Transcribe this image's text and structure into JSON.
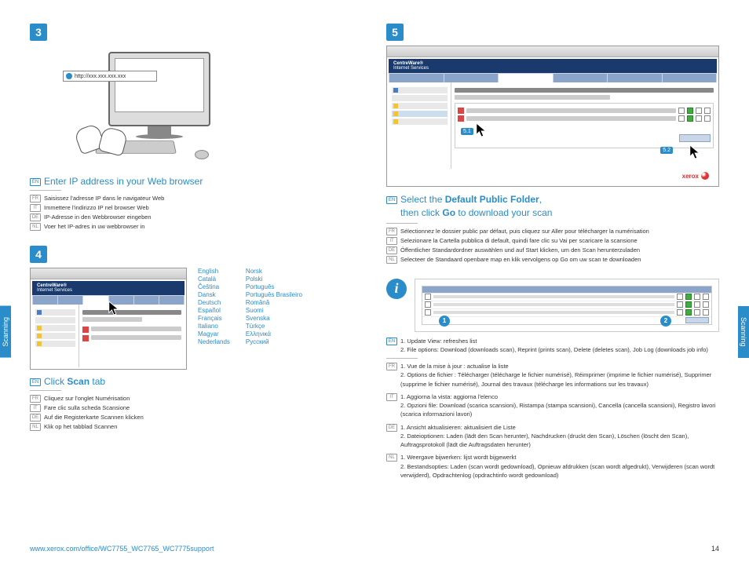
{
  "side_tab": "Scanning",
  "url_placeholder": "http://xxx.xxx.xxx.xxx",
  "cw_title": "CentreWare®",
  "cw_subtitle": "Internet Services",
  "xerox": "xerox",
  "step3": {
    "num": "3",
    "heading_pre": "Enter IP address in your Web browser",
    "trans": {
      "fr": "Saisissez l'adresse IP dans le navigateur Web",
      "it": "Immettere l'indirizzo IP nel browser Web",
      "de": "IP-Adresse in den Webbrowser eingeben",
      "nl": "Voer het IP-adres in uw webbrowser in"
    }
  },
  "step4": {
    "num": "4",
    "heading_html": {
      "pre": "Click ",
      "bold": "Scan",
      "post": " tab"
    },
    "trans": {
      "fr": "Cliquez sur l'onglet Numérisation",
      "it": "Fare clic sulla scheda Scansione",
      "de": "Auf die Registerkarte Scannen klicken",
      "nl": "Klik op het tabblad Scannen"
    },
    "langs_col1": [
      "English",
      "Català",
      "Čeština",
      "Dansk",
      "Deutsch",
      "Español",
      "Français",
      "Italiano",
      "Magyar",
      "Nederlands"
    ],
    "langs_col2": [
      "Norsk",
      "Polski",
      "Português",
      "Português Brasileiro",
      "Română",
      "Suomi",
      "Svenska",
      "Türkçe",
      "Ελληνικά",
      "Русский"
    ]
  },
  "step5": {
    "num": "5",
    "callout1": "5.1",
    "callout2": "5.2",
    "heading": {
      "l1_pre": "Select the ",
      "l1_bold": "Default Public Folder",
      "l1_post": ",",
      "l2_pre": "then click ",
      "l2_bold": "Go",
      "l2_post": " to download your scan"
    },
    "trans": {
      "fr": "Sélectionnez le dossier public par défaut, puis cliquez sur Aller pour télécharger la numérisation",
      "it": "Selezionare la Cartella pubblica di default, quindi fare clic su Vai per scaricare la scansione",
      "de": "Öffentlicher Standardordner auswählen und auf Start klicken, um den Scan herunterzuladen",
      "nl": "Selecteer de Standaard openbare map en klik vervolgens op Go om uw scan te downloaden"
    }
  },
  "info": {
    "c1": "1",
    "c2": "2",
    "en": {
      "l1": "1. Update View: refreshes list",
      "l2": "2. File options: Download (downloads scan), Reprint (prints scan), Delete (deletes scan), Job Log (downloads job info)"
    },
    "fr": {
      "l1": "1. Vue de la mise à jour : actualise la liste",
      "l2": "2. Options de fichier : Télécharger (télécharge le fichier numérisé), Réimprimer (imprime le fichier numérisé), Supprimer (supprime le fichier numérisé), Journal des travaux (télécharge les informations sur les travaux)"
    },
    "it": {
      "l1": "1. Aggiorna la vista: aggiorna l'elenco",
      "l2": "2. Opzioni file: Download (scarica scansioni), Ristampa (stampa scansioni), Cancella (cancella scansioni), Registro lavori (scarica informazioni lavori)"
    },
    "de": {
      "l1": "1. Ansicht aktualisieren: aktualisiert die Liste",
      "l2": "2. Dateioptionen: Laden (lädt den Scan herunter), Nachdrucken (druckt den Scan), Löschen (löscht den Scan), Auftragsprotokoll (lädt die Auftragsdaten herunter)"
    },
    "nl": {
      "l1": "1. Weergave bijwerken: lijst wordt bijgewerkt",
      "l2": "2. Bestandsopties: Laden (scan wordt gedownload), Opnieuw afdrukken (scan wordt afgedrukt), Verwijderen (scan wordt verwijderd), Opdrachtenlog (opdrachtinfo wordt gedownload)"
    }
  },
  "footer": {
    "url": "www.xerox.com/office/WC7755_WC7765_WC7775support",
    "page": "14"
  },
  "badges": {
    "en": "EN",
    "fr": "FR",
    "it": "IT",
    "de": "DE",
    "nl": "NL"
  }
}
